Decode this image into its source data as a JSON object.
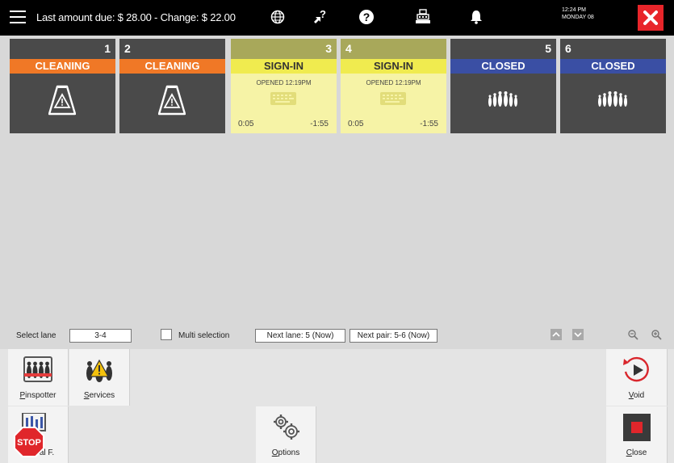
{
  "topbar": {
    "amount_text": "Last amount due: $ 28.00 - Change: $ 22.00",
    "time": "12:24 PM",
    "day": "MONDAY 08",
    "icons": [
      "menu-icon",
      "globe-icon",
      "help-cursor-icon",
      "question-icon",
      "cash-register-icon",
      "bell-icon",
      "close-icon"
    ]
  },
  "lanes": [
    {
      "number": "1",
      "status": "CLEANING",
      "state": "cleaning",
      "icon": "wet-floor-warning-icon"
    },
    {
      "number": "2",
      "status": "CLEANING",
      "state": "cleaning",
      "icon": "wet-floor-warning-icon"
    },
    {
      "number": "3",
      "status": "SIGN-IN",
      "state": "signin",
      "opened": "OPENED 12:19PM",
      "elapsed": "0:05",
      "remaining": "-1:55",
      "icon": "keyboard-icon"
    },
    {
      "number": "4",
      "status": "SIGN-IN",
      "state": "signin",
      "opened": "OPENED 12:19PM",
      "elapsed": "0:05",
      "remaining": "-1:55",
      "icon": "keyboard-icon"
    },
    {
      "number": "5",
      "status": "CLOSED",
      "state": "closed",
      "icon": "bowling-pins-icon"
    },
    {
      "number": "6",
      "status": "CLOSED",
      "state": "closed",
      "icon": "bowling-pins-icon"
    }
  ],
  "selection": {
    "select_lane_label": "Select lane",
    "select_lane_value": "3-4",
    "multi_selection_label": "Multi selection",
    "next_lane": "Next lane: 5 (Now)",
    "next_pair": "Next pair: 5-6 (Now)"
  },
  "buttons": {
    "pinspotter": {
      "first": "P",
      "rest": "inspotter"
    },
    "services": {
      "first": "S",
      "rest": "ervices"
    },
    "special": {
      "shown": "al F."
    },
    "options": {
      "first": "O",
      "rest": "ptions"
    },
    "void": {
      "first": "V",
      "rest": "oid"
    },
    "close": {
      "first": "C",
      "rest": "lose"
    }
  },
  "stop_label": "STOP",
  "colors": {
    "cleaning": "#f07826",
    "signin": "#f0eb4f",
    "closed": "#3a4fa4",
    "close_button": "#e8252a",
    "void_red": "#d9262c"
  }
}
